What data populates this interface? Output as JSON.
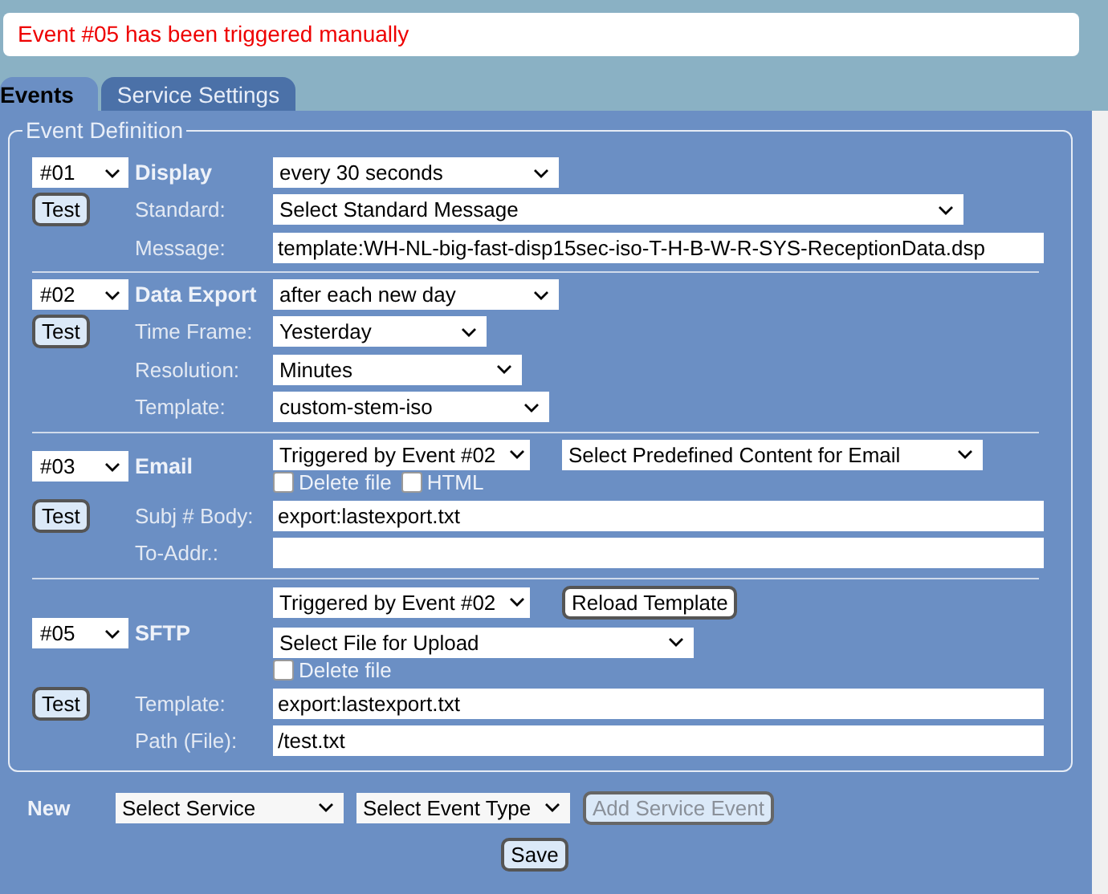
{
  "notice": "Event #05 has been triggered manually",
  "tabs": [
    {
      "label": "Events",
      "selected": true
    },
    {
      "label": "Service Settings",
      "selected": false
    }
  ],
  "legend": "Event Definition",
  "events": [
    {
      "number": "#01",
      "type": "Display",
      "test": "Test",
      "head_lines": [
        [
          {
            "kind": "select",
            "value": "every 30 seconds"
          }
        ]
      ],
      "fields": [
        {
          "label": "Standard:",
          "control": {
            "kind": "select",
            "value": "Select Standard Message"
          }
        },
        {
          "label": "Message:",
          "control": {
            "kind": "input",
            "value": "template:WH-NL-big-fast-disp15sec-iso-T-H-B-W-R-SYS-ReceptionData.dsp"
          }
        }
      ]
    },
    {
      "number": "#02",
      "type": "Data Export",
      "test": "Test",
      "head_lines": [
        [
          {
            "kind": "select",
            "value": "after each new day"
          }
        ]
      ],
      "fields": [
        {
          "label": "Time Frame:",
          "control": {
            "kind": "select",
            "value": "Yesterday"
          }
        },
        {
          "label": "Resolution:",
          "control": {
            "kind": "select",
            "value": "Minutes"
          }
        },
        {
          "label": "Template:",
          "control": {
            "kind": "select",
            "value": "custom-stem-iso"
          }
        }
      ]
    },
    {
      "number": "#03",
      "type": "Email",
      "test": "Test",
      "head_lines": [
        [
          {
            "kind": "select",
            "value": "Triggered by Event #02"
          },
          {
            "kind": "select",
            "value": "Select Predefined Content for Email"
          }
        ],
        [
          {
            "kind": "checkbox",
            "label": "Delete file",
            "checked": false
          },
          {
            "kind": "checkbox",
            "label": "HTML",
            "checked": false
          }
        ]
      ],
      "fields": [
        {
          "label": "Subj # Body:",
          "control": {
            "kind": "input",
            "value": "export:lastexport.txt"
          }
        },
        {
          "label": "To-Addr.:",
          "control": {
            "kind": "input"
          }
        }
      ]
    },
    {
      "number": "#05",
      "type": "SFTP",
      "test": "Test",
      "head_lines": [
        [
          {
            "kind": "select",
            "value": "Triggered by Event #02"
          },
          {
            "kind": "button",
            "label": "Reload Template"
          }
        ],
        [
          {
            "kind": "select",
            "value": "Select File for Upload"
          }
        ],
        [
          {
            "kind": "checkbox",
            "label": "Delete file",
            "checked": false
          }
        ]
      ],
      "fields": [
        {
          "label": "Template:",
          "control": {
            "kind": "input",
            "value": "export:lastexport.txt"
          }
        },
        {
          "label": "Path (File):",
          "control": {
            "kind": "input",
            "value": "/test.txt"
          }
        }
      ]
    }
  ],
  "new_row": {
    "label": "New",
    "service": "Select Service",
    "event_type": "Select Event Type",
    "add": {
      "label": "Add Service Event",
      "disabled": true
    }
  },
  "save": "Save"
}
